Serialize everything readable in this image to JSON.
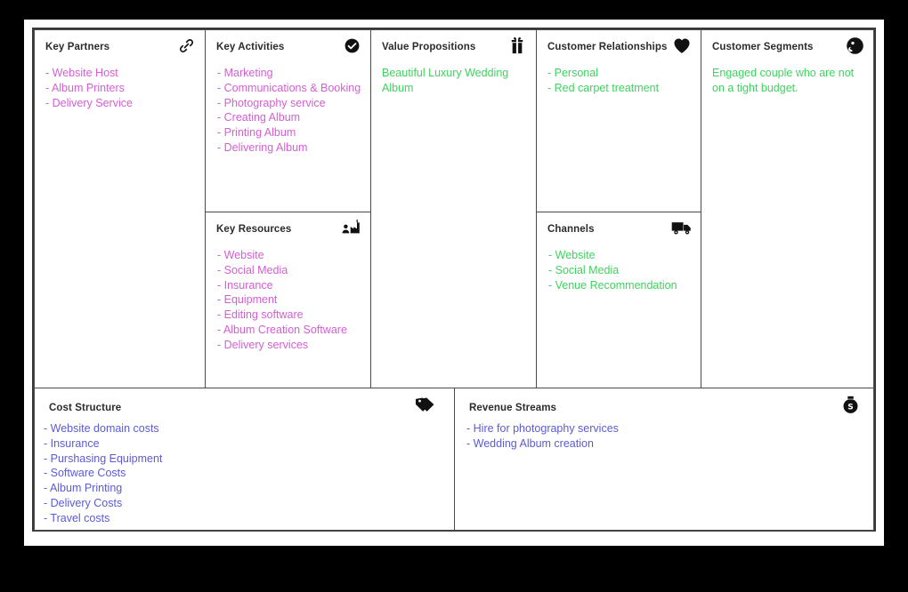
{
  "canvas": {
    "colors": {
      "background": "#000000",
      "sheet": "#ffffff",
      "border": "#3a3a3a",
      "magenta": "#d45fd4",
      "green": "#3ed35f",
      "blue": "#5b5bd6"
    }
  },
  "panels": {
    "key_partners": {
      "title": "Key Partners",
      "icon": "link-icon",
      "items": [
        "- Website Host",
        "- Album Printers",
        "- Delivery Service"
      ]
    },
    "key_activities": {
      "title": "Key Activities",
      "icon": "check-circle-icon",
      "items": [
        "- Marketing",
        "- Communications & Booking",
        "- Photography service",
        "- Creating Album",
        "- Printing Album",
        "- Delivering Album"
      ]
    },
    "key_resources": {
      "title": "Key Resources",
      "icon": "factory-worker-icon",
      "items": [
        "- Website",
        "- Social Media",
        "- Insurance",
        "- Equipment",
        "- Editing software",
        "- Album Creation Software",
        "- Delivery services"
      ]
    },
    "value_propositions": {
      "title": "Value Propositions",
      "icon": "gift-icon",
      "items": [
        "Beautiful Luxury Wedding Album"
      ]
    },
    "customer_relationships": {
      "title": "Customer Relationships",
      "icon": "heart-icon",
      "items": [
        "- Personal",
        "- Red carpet treatment"
      ]
    },
    "channels": {
      "title": "Channels",
      "icon": "truck-icon",
      "items": [
        "- Website",
        "- Social Media",
        "- Venue Recommendation"
      ]
    },
    "customer_segments": {
      "title": "Customer Segments",
      "icon": "profile-circle-icon",
      "items": [
        "Engaged couple who are not on a tight budget."
      ]
    },
    "cost_structure": {
      "title": "Cost Structure",
      "icon": "price-tag-icon",
      "items": [
        "- Website domain costs",
        "- Insurance",
        "- Purshasing Equipment",
        "- Software Costs",
        "- Album Printing",
        "- Delivery Costs",
        "- Travel costs"
      ]
    },
    "revenue_streams": {
      "title": "Revenue Streams",
      "icon": "money-bag-icon",
      "items": [
        "- Hire for photography services",
        "- Wedding Album creation"
      ]
    }
  }
}
